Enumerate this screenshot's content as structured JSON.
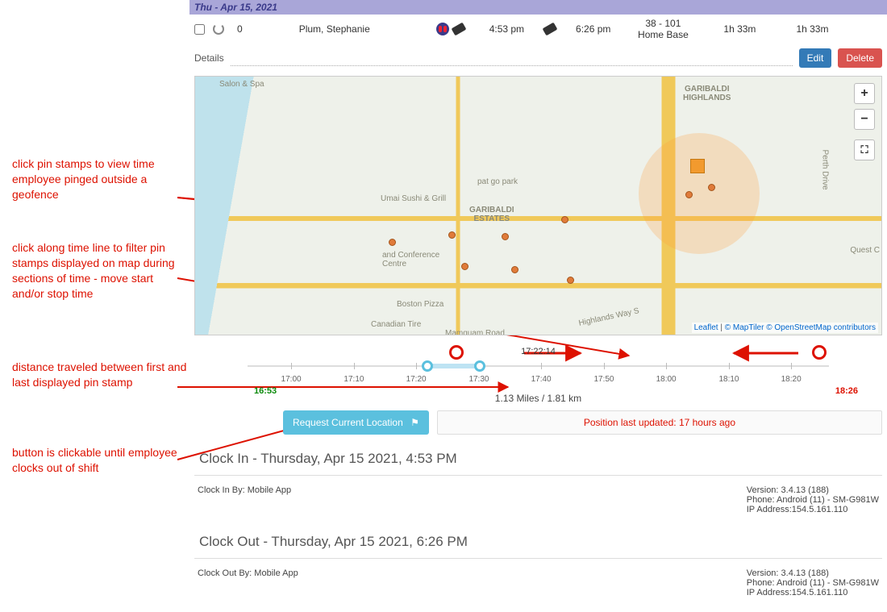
{
  "dateBar": "Thu - Apr 15, 2021",
  "row": {
    "zero": "0",
    "name": "Plum, Stephanie",
    "t1": "4:53 pm",
    "t2": "6:26 pm",
    "loc_id": "38 - 101",
    "loc_name": "Home Base",
    "dur1": "1h 33m",
    "dur2": "1h 33m"
  },
  "details": {
    "label": "Details",
    "value": ""
  },
  "buttons": {
    "edit": "Edit",
    "delete": "Delete",
    "request": "Request Current Location"
  },
  "map": {
    "labels": {
      "salon": "Salon & Spa",
      "estates": "GARIBALDI\nESTATES",
      "highlands": "GARIBALDI\nHIGHLANDS",
      "sushi": "Umai Sushi & Grill",
      "hotel": "and Conference\nCentre",
      "pat": "pat go park",
      "pizza": "Boston Pizza",
      "tire": "Canadian Tire",
      "mam": "Mamquam Road",
      "hwy": "Highlands Way S",
      "perth": "Perth Drive",
      "quest": "Quest C"
    },
    "attr": {
      "leaflet": "Leaflet",
      "maptiler": "© MapTiler",
      "osm": "© OpenStreetMap contributors"
    },
    "controls": {
      "zoom_in": "+",
      "zoom_out": "−",
      "full": "⛶"
    }
  },
  "timeline": {
    "center": "17:22:14",
    "start": "16:53",
    "end": "18:26",
    "ticks": [
      "17:00",
      "17:10",
      "17:20",
      "17:30",
      "17:40",
      "17:50",
      "18:00",
      "18:10",
      "18:20"
    ]
  },
  "distance": "1.13 Miles / 1.81 km",
  "position_updated": "Position last updated: 17 hours ago",
  "clock_in": {
    "head": "Clock In - Thursday, Apr 15 2021, 4:53 PM",
    "by": "Clock In By: Mobile App",
    "ver": "Version: 3.4.13 (188)",
    "phone": "Phone: Android (11) - SM-G981W",
    "ip": "IP Address:154.5.161.110"
  },
  "clock_out": {
    "head": "Clock Out - Thursday, Apr 15 2021, 6:26 PM",
    "by": "Clock Out By: Mobile App",
    "ver": "Version: 3.4.13 (188)",
    "phone": "Phone: Android (11) - SM-G981W",
    "ip": "IP Address:154.5.161.110"
  },
  "annotations": {
    "a1": "click pin stamps to view time employee pinged outside a geofence",
    "a2": "click along time line to filter pin stamps displayed on map during sections of time - move start and/or stop time",
    "a3": "distance traveled between first and last displayed pin stamp",
    "a4": "button is clickable until employee clocks out of shift"
  }
}
